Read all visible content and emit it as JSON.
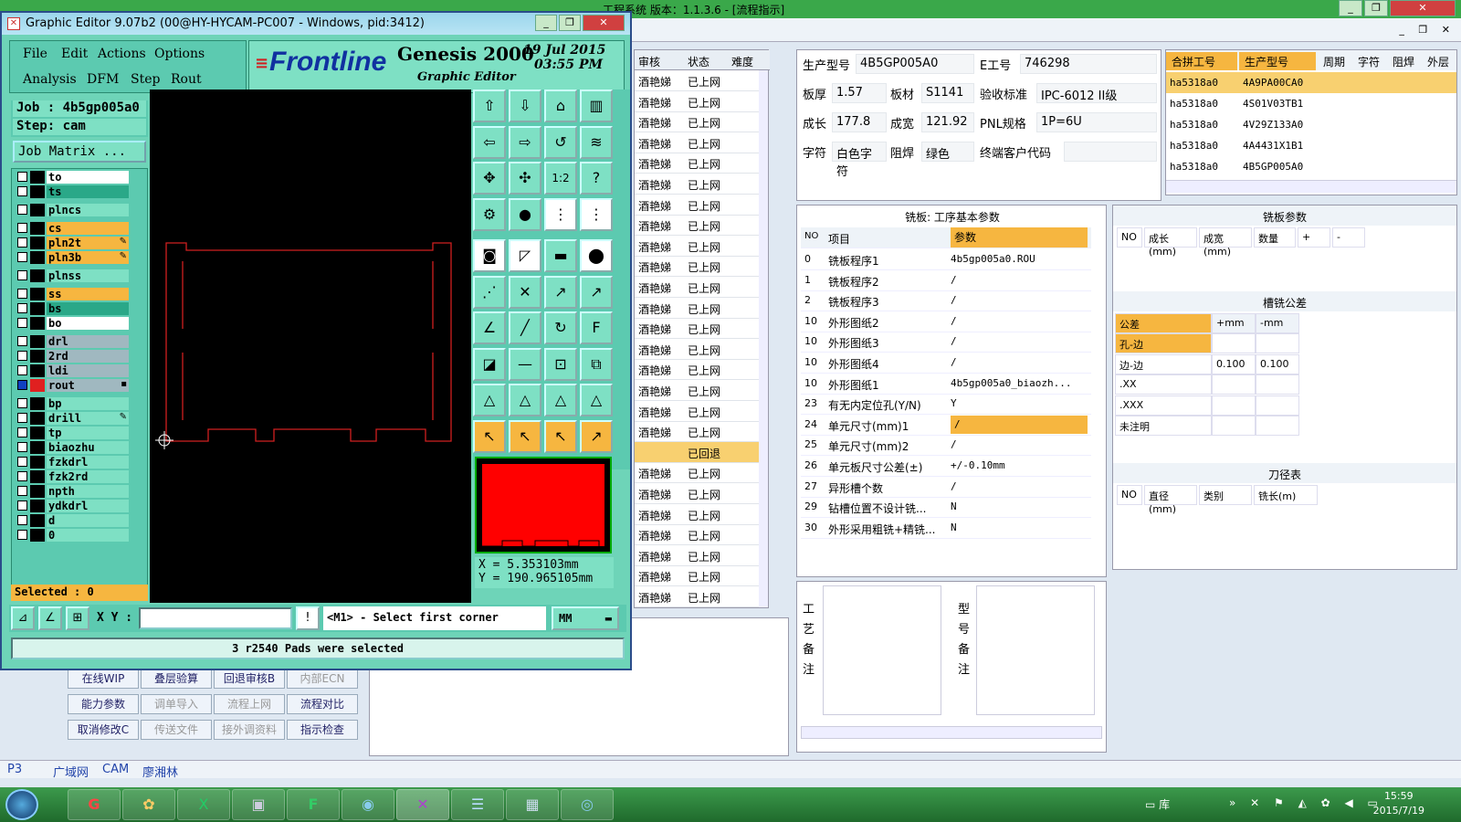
{
  "bg_app": {
    "title": "工程系统  版本：1.1.3.6 - [流程指示]",
    "status_header": [
      "审核",
      "状态",
      "难度"
    ],
    "status_rows": [
      {
        "a": "酒艳娣",
        "b": "已上网"
      },
      {
        "a": "酒艳娣",
        "b": "已上网"
      },
      {
        "a": "酒艳娣",
        "b": "已上网"
      },
      {
        "a": "酒艳娣",
        "b": "已上网"
      },
      {
        "a": "酒艳娣",
        "b": "已上网"
      },
      {
        "a": "酒艳娣",
        "b": "已上网"
      },
      {
        "a": "酒艳娣",
        "b": "已上网"
      },
      {
        "a": "酒艳娣",
        "b": "已上网"
      },
      {
        "a": "酒艳娣",
        "b": "已上网"
      },
      {
        "a": "酒艳娣",
        "b": "已上网"
      },
      {
        "a": "酒艳娣",
        "b": "已上网"
      },
      {
        "a": "酒艳娣",
        "b": "已上网"
      },
      {
        "a": "酒艳娣",
        "b": "已上网"
      },
      {
        "a": "酒艳娣",
        "b": "已上网"
      },
      {
        "a": "酒艳娣",
        "b": "已上网"
      },
      {
        "a": "酒艳娣",
        "b": "已上网"
      },
      {
        "a": "酒艳娣",
        "b": "已上网"
      },
      {
        "a": "酒艳娣",
        "b": "已上网"
      },
      {
        "a": "",
        "b": "已回退",
        "sel": true
      },
      {
        "a": "酒艳娣",
        "b": "已上网"
      },
      {
        "a": "酒艳娣",
        "b": "已上网"
      },
      {
        "a": "酒艳娣",
        "b": "已上网"
      },
      {
        "a": "酒艳娣",
        "b": "已上网"
      },
      {
        "a": "酒艳娣",
        "b": "已上网"
      },
      {
        "a": "酒艳娣",
        "b": "已上网"
      },
      {
        "a": "酒艳娣",
        "b": "已上网"
      }
    ],
    "info": {
      "model_label": "生产型号",
      "model": "4B5GP005A0",
      "e_label": "E工号",
      "e_no": "746298",
      "thick_label": "板厚",
      "thick": "1.57",
      "mat_label": "板材",
      "mat": "S1141",
      "std_label": "验收标准",
      "std": "IPC-6012 II级",
      "len_label": "成长",
      "len": "177.8",
      "wid_label": "成宽",
      "wid": "121.92",
      "pnl_label": "PNL规格",
      "pnl": "1P=6U",
      "char_label": "字符",
      "char": "白色字符",
      "mask_label": "阻焊",
      "mask": "绿色",
      "cust_label": "终端客户代码",
      "cust": ""
    },
    "parts_header": [
      "合拼工号",
      "生产型号",
      "周期",
      "字符",
      "阻焊",
      "外层"
    ],
    "parts_rows": [
      [
        "ha5318a0",
        "4A9PA00CA0"
      ],
      [
        "ha5318a0",
        "4S01V03TB1"
      ],
      [
        "ha5318a0",
        "4V29Z133A0"
      ],
      [
        "ha5318a0",
        "4A4431X1B1"
      ],
      [
        "ha5318a0",
        "4B5GP005A0"
      ]
    ],
    "params_title": "铣板: 工序基本参数",
    "params_header": [
      "NO",
      "项目",
      "参数"
    ],
    "params_rows": [
      [
        "0",
        "铣板程序1",
        "4b5gp005a0.ROU"
      ],
      [
        "1",
        "铣板程序2",
        "/"
      ],
      [
        "2",
        "铣板程序3",
        "/"
      ],
      [
        "10",
        "外形图纸2",
        "/"
      ],
      [
        "10",
        "外形图纸3",
        "/"
      ],
      [
        "10",
        "外形图纸4",
        "/"
      ],
      [
        "10",
        "外形图纸1",
        "4b5gp005a0_biaozh..."
      ],
      [
        "23",
        "有无内定位孔(Y/N)",
        "Y"
      ],
      [
        "24",
        "单元尺寸(mm)1",
        "/"
      ],
      [
        "25",
        "单元尺寸(mm)2",
        "/"
      ],
      [
        "26",
        "单元板尺寸公差(±)",
        "+/-0.10mm"
      ],
      [
        "27",
        "异形槽个数",
        "/"
      ],
      [
        "29",
        "钻槽位置不设计铣...",
        "N"
      ],
      [
        "30",
        "外形采用粗铣+精铣...",
        "N"
      ]
    ],
    "mill_title": "铣板参数",
    "mill_header": [
      "NO",
      "成长(mm)",
      "成宽(mm)",
      "数量",
      "+",
      "-"
    ],
    "slot_title": "槽铣公差",
    "slot_header": [
      "公差",
      "+mm",
      "-mm"
    ],
    "slot_rows": [
      [
        "孔-边",
        "",
        ""
      ],
      [
        "边-边",
        "0.100",
        "0.100"
      ],
      [
        ".XX",
        "",
        ""
      ],
      [
        ".XXX",
        "",
        ""
      ],
      [
        "未注明",
        "",
        ""
      ]
    ],
    "tool_title": "刀径表",
    "tool_header": [
      "NO",
      "直径(mm)",
      "类别",
      "铣长(m)"
    ],
    "notes_label1": "工艺备注",
    "notes_label2": "型号备注",
    "func_buttons": [
      {
        "label": "在线WIP",
        "dis": false
      },
      {
        "label": "叠层验算",
        "dis": false
      },
      {
        "label": "回退审核B",
        "dis": false
      },
      {
        "label": "内部ECN",
        "dis": true
      },
      {
        "label": "能力参数",
        "dis": false
      },
      {
        "label": "调单导入",
        "dis": true
      },
      {
        "label": "流程上网",
        "dis": true
      },
      {
        "label": "流程对比",
        "dis": false
      },
      {
        "label": "取消修改C",
        "dis": false
      },
      {
        "label": "传送文件",
        "dis": true
      },
      {
        "label": "接外调资料",
        "dis": true
      },
      {
        "label": "指示检查",
        "dis": false
      }
    ],
    "bottombar": [
      "P3",
      "广域网",
      "CAM",
      "廖湘林"
    ]
  },
  "genesis": {
    "title": "Graphic Editor 9.07b2 (00@HY-HYCAM-PC007 - Windows, pid:3412)",
    "menu": [
      "File",
      "Edit",
      "Actions",
      "Options",
      "Analysis",
      "DFM",
      "Step",
      "Rout"
    ],
    "brand": "Frontline",
    "product": "Genesis 2000",
    "subtitle": "Graphic Editor",
    "date": "19 Jul 2015",
    "time": "03:55 PM",
    "job": "Job : 4b5gp005a0",
    "step": "Step: cam",
    "job_matrix": "Job Matrix ...",
    "layers": [
      {
        "name": "to",
        "color": "#ffffff"
      },
      {
        "name": "ts",
        "color": "#2aa888"
      },
      {
        "name": "plncs",
        "color": "#7ee0c4"
      },
      {
        "name": "cs",
        "color": "#f6b640"
      },
      {
        "name": "pln2t",
        "color": "#f6b640"
      },
      {
        "name": "pln3b",
        "color": "#f6b640"
      },
      {
        "name": "plnss",
        "color": "#7ee0c4"
      },
      {
        "name": "ss",
        "color": "#f6b640"
      },
      {
        "name": "bs",
        "color": "#2aa888"
      },
      {
        "name": "bo",
        "color": "#ffffff"
      },
      {
        "name": "drl",
        "color": "#a0b8c0"
      },
      {
        "name": "2rd",
        "color": "#a0b8c0"
      },
      {
        "name": "ldi",
        "color": "#a0b8c0"
      },
      {
        "name": "rout",
        "color": "#a0b8c0"
      },
      {
        "name": "bp",
        "color": "#7ee0c4"
      },
      {
        "name": "drill",
        "color": "#7ee0c4"
      },
      {
        "name": "tp",
        "color": "#7ee0c4"
      },
      {
        "name": "biaozhu",
        "color": "#7ee0c4"
      },
      {
        "name": "fzkdrl",
        "color": "#7ee0c4"
      },
      {
        "name": "fzk2rd",
        "color": "#7ee0c4"
      },
      {
        "name": "npth",
        "color": "#7ee0c4"
      },
      {
        "name": "ydkdrl",
        "color": "#7ee0c4"
      },
      {
        "name": "d",
        "color": "#7ee0c4"
      },
      {
        "name": "0",
        "color": "#7ee0c4"
      }
    ],
    "selected": "Selected : 0",
    "coord_x": "X =  5.353103mm",
    "coord_y": "Y = 190.965105mm",
    "xy_label": "X Y :",
    "xy_value": "",
    "prompt": "<M1> - Select first corner",
    "units": "MM",
    "status": "3 r2540 Pads were selected",
    "accent": "#6ed4b8"
  },
  "taskbar": {
    "time": "15:59",
    "date": "2015/7/19",
    "lib": "库"
  }
}
